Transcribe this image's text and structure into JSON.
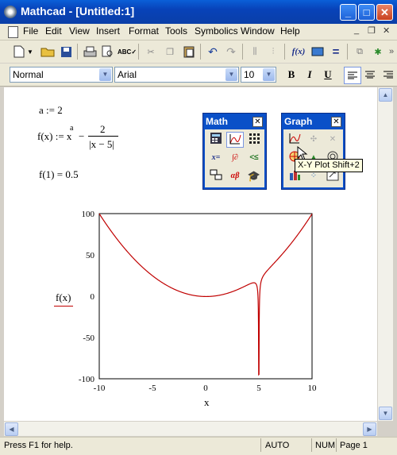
{
  "window": {
    "title": "Mathcad - [Untitled:1]"
  },
  "menu": {
    "items": [
      "File",
      "Edit",
      "View",
      "Insert",
      "Format",
      "Tools",
      "Symbolics",
      "Window",
      "Help"
    ]
  },
  "format_bar": {
    "style_value": "Normal",
    "font_value": "Arial",
    "size_value": "10",
    "bold": "B",
    "italic": "I",
    "underline": "U"
  },
  "worksheet": {
    "def_a": "a := 2",
    "def_f_lhs": "f(x) := x",
    "def_f_exp": "a",
    "def_f_minus": "−",
    "def_f_num": "2",
    "def_f_den": "|x − 5|",
    "eval": "f(1) = 0.5",
    "plot_ylabel": "f(x)",
    "plot_xlabel": "x"
  },
  "palettes": {
    "math": {
      "title": "Math",
      "close": "✕"
    },
    "graph": {
      "title": "Graph",
      "close": "✕",
      "tooltip": "X-Y Plot Shift+2"
    }
  },
  "status": {
    "help": "Press F1 for help.",
    "mode": "AUTO",
    "num": "NUM",
    "page": "Page 1"
  },
  "colors": {
    "curve": "#c00000",
    "title_bar": "#0842b8"
  },
  "chart_data": {
    "type": "line",
    "xlim": [
      -10,
      10
    ],
    "ylim": [
      -100,
      100
    ],
    "xticks": [
      -10,
      -5,
      0,
      5,
      10
    ],
    "yticks": [
      -100,
      -50,
      0,
      50,
      100
    ],
    "series": [
      {
        "formula": "x^2 - 2/|x-5|"
      }
    ],
    "xlabel": "x",
    "ylabel": "f(x)"
  }
}
